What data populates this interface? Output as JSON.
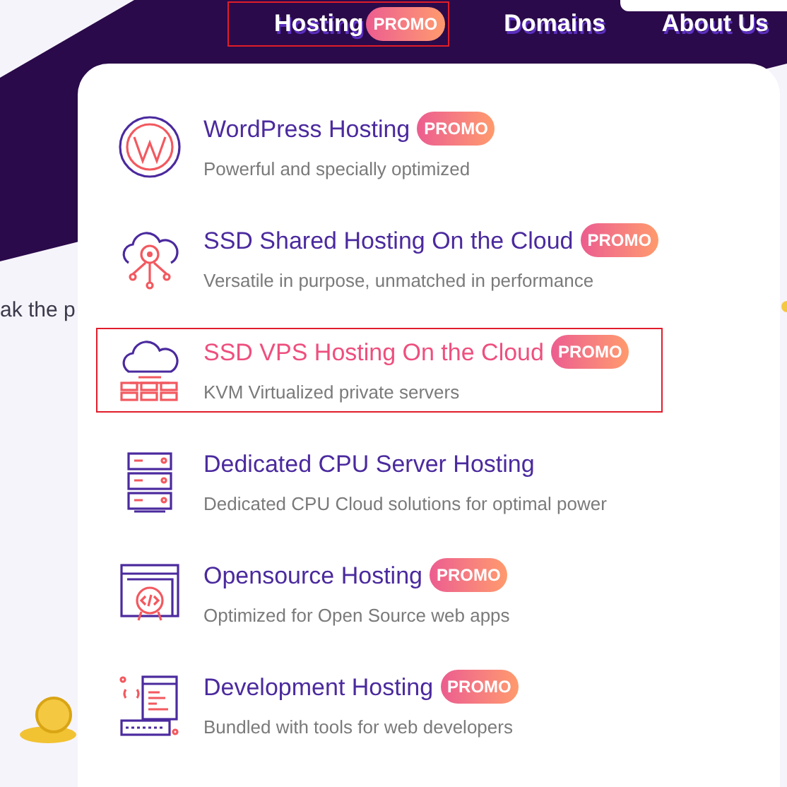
{
  "nav": [
    {
      "label": "Hosting",
      "badge": "PROMO",
      "selected": true
    },
    {
      "label": "Domains",
      "selected": false
    },
    {
      "label": "About Us",
      "selected": false
    }
  ],
  "background_text": "ak the p",
  "menu": [
    {
      "title": "WordPress Hosting",
      "badge": "PROMO",
      "description": "Powerful and specially optimized",
      "selected": false
    },
    {
      "title": "SSD Shared Hosting On the Cloud",
      "badge": "PROMO",
      "description": "Versatile in purpose, unmatched in performance",
      "selected": false
    },
    {
      "title": "SSD VPS Hosting On the Cloud",
      "badge": "PROMO",
      "description": "KVM Virtualized private servers",
      "selected": true
    },
    {
      "title": "Dedicated CPU Server Hosting",
      "description": "Dedicated CPU Cloud solutions for optimal power",
      "selected": false
    },
    {
      "title": "Opensource Hosting",
      "badge": "PROMO",
      "description": "Optimized for Open Source web apps",
      "selected": false
    },
    {
      "title": "Development Hosting",
      "badge": "PROMO",
      "description": "Bundled with tools for web developers",
      "selected": false
    }
  ]
}
